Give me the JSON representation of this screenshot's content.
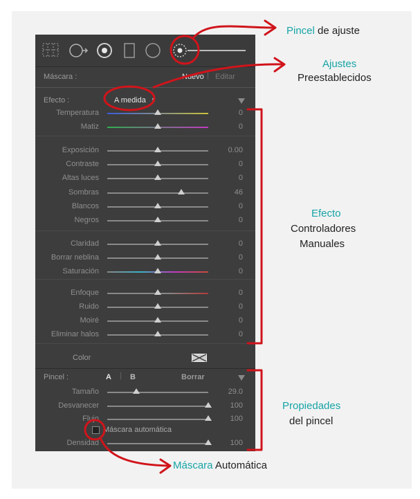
{
  "panel": {
    "mask_label": "Máscara :",
    "mask_new": "Nuevo",
    "mask_edit": "Editar",
    "effect_label": "Efecto :",
    "effect_value": "A medida",
    "color_label": "Color",
    "brush_label": "Pincel :",
    "brush_a": "A",
    "brush_b": "B",
    "brush_erase": "Borrar",
    "auto_mask_label": "Máscara automática"
  },
  "sliders": [
    {
      "label": "Temperatura",
      "value": "0",
      "pos": 0.5
    },
    {
      "label": "Matiz",
      "value": "0",
      "pos": 0.5
    },
    {
      "label": "Exposición",
      "value": "0.00",
      "pos": 0.5
    },
    {
      "label": "Contraste",
      "value": "0",
      "pos": 0.5
    },
    {
      "label": "Altas luces",
      "value": "0",
      "pos": 0.5
    },
    {
      "label": "Sombras",
      "value": "46",
      "pos": 0.73
    },
    {
      "label": "Blancos",
      "value": "0",
      "pos": 0.5
    },
    {
      "label": "Negros",
      "value": "0",
      "pos": 0.5
    },
    {
      "label": "Claridad",
      "value": "0",
      "pos": 0.5
    },
    {
      "label": "Borrar neblina",
      "value": "0",
      "pos": 0.5
    },
    {
      "label": "Saturación",
      "value": "0",
      "pos": 0.5
    },
    {
      "label": "Enfoque",
      "value": "0",
      "pos": 0.5
    },
    {
      "label": "Ruido",
      "value": "0",
      "pos": 0.5
    },
    {
      "label": "Moiré",
      "value": "0",
      "pos": 0.5
    },
    {
      "label": "Eliminar halos",
      "value": "0",
      "pos": 0.5
    }
  ],
  "brush": [
    {
      "label": "Tamaño",
      "value": "29.0",
      "pos": 0.29
    },
    {
      "label": "Desvanecer",
      "value": "100",
      "pos": 1.0
    },
    {
      "label": "Flujo",
      "value": "100",
      "pos": 1.0
    },
    {
      "label": "Densidad",
      "value": "100",
      "pos": 1.0
    }
  ],
  "annotations": {
    "pincel_1": "Pincel",
    "pincel_2": "de ajuste",
    "ajustes_1": "Ajustes",
    "ajustes_2": "Preestablecidos",
    "efecto_1": "Efecto",
    "efecto_2": "Controladores",
    "efecto_3": "Manuales",
    "prop_1": "Propiedades",
    "prop_2": "del pincel",
    "mask_1": "Máscara",
    "mask_2": "Automática"
  },
  "colors": {
    "accent": "#17a4a6",
    "annotation_red": "#d0141b",
    "panel_bg": "#3d3d3d"
  }
}
